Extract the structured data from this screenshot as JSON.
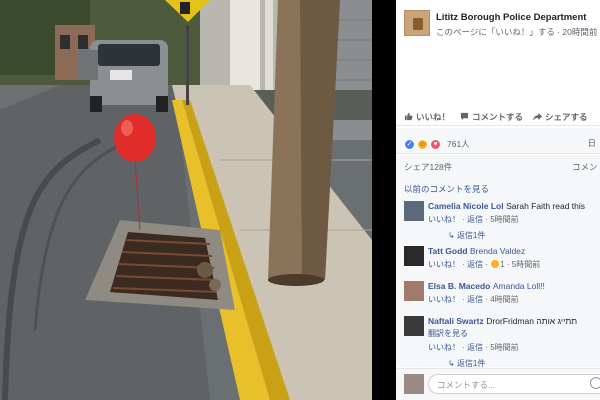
{
  "post": {
    "page_name": "Lititz Borough Police Department",
    "meta": "このページに「いいね！」する · 20時間前"
  },
  "actions": [
    {
      "label": "いいね！",
      "icon": "thumbs-up-icon"
    },
    {
      "label": "コメントする",
      "icon": "comment-icon"
    },
    {
      "label": "シェアする",
      "icon": "share-icon"
    }
  ],
  "reactions": {
    "count": "761人",
    "right_tag": "日"
  },
  "shares": {
    "label": "シェア128件",
    "right_tag": "コメント"
  },
  "comments_prev": "以前のコメントを見る",
  "comments": [
    {
      "name": "Camelia Nicole Lol",
      "text": "Sarah Faith read this",
      "like": "いいね！",
      "reply": "返信",
      "time": "5時間前",
      "replies": "返信1件"
    },
    {
      "name": "Tatt Godd",
      "text": "Brenda Valdez",
      "like": "いいね！",
      "reply": "返信",
      "reaction_count": "1",
      "time": "5時間前",
      "replies": ""
    },
    {
      "name": "Elsa B. Macedo",
      "text": "Amanda Loll!!",
      "like": "いいね！",
      "reply": "返信",
      "time": "4時間前",
      "replies": ""
    },
    {
      "name": "Naftali Swartz",
      "text": "DrorFridman תתייג אותה",
      "translate": "翻訳を見る",
      "like": "いいね！",
      "reply": "返信",
      "time": "5時間前",
      "replies": "返信1件"
    }
  ],
  "composer": {
    "placeholder": "コメントする..."
  },
  "colors": {
    "fb_blue": "#385898",
    "like_blue": "#4080ff",
    "love_red": "#f25268",
    "haha_yellow": "#f7b125"
  }
}
